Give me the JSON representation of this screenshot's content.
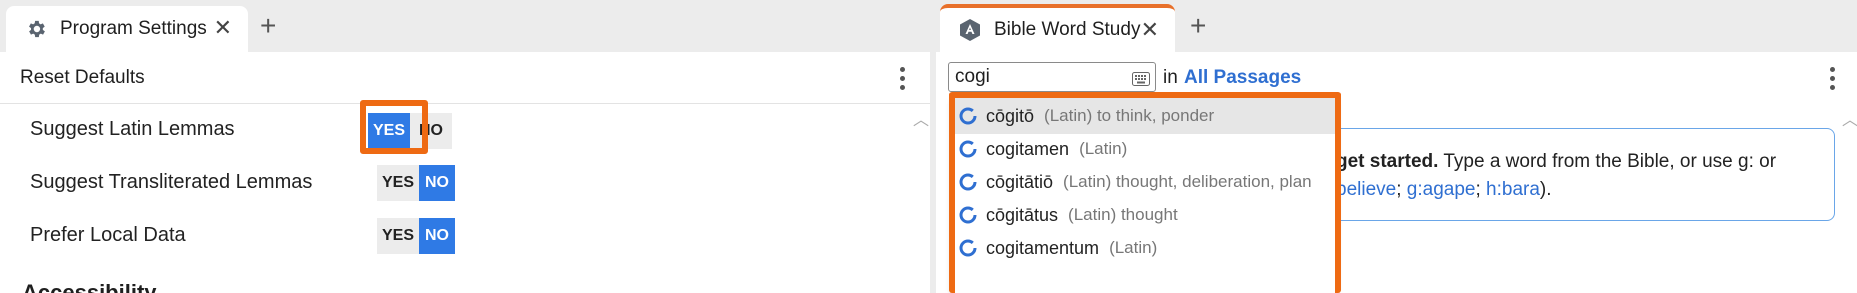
{
  "tabs": {
    "left": {
      "title": "Program Settings",
      "icon": "gear-icon",
      "close": "✕",
      "new_tab": "+"
    },
    "right": {
      "title": "Bible Word Study",
      "icon": "word-study-icon",
      "close": "✕",
      "new_tab": "+",
      "accent_color": "#e8702a"
    }
  },
  "settings": {
    "reset_label": "Reset Defaults",
    "rows": [
      {
        "label": "Suggest Latin Lemmas",
        "yes": "YES",
        "no": "NO",
        "value": "YES"
      },
      {
        "label": "Suggest Transliterated Lemmas",
        "yes": "YES",
        "no": "NO",
        "value": "NO"
      },
      {
        "label": "Prefer Local Data",
        "yes": "YES",
        "no": "NO",
        "value": "NO"
      }
    ],
    "next_section": "Accessibility"
  },
  "word_study": {
    "search_value": "cogi",
    "in_label": "in",
    "range_link": "All Passages",
    "info": {
      "line1_bold": "get started.",
      "line1_rest": " Type a word from the Bible, or use g: or",
      "line2_link1": "believe",
      "line2_sep1": "; ",
      "line2_link2": "g:agape",
      "line2_sep2": "; ",
      "line2_link3": "h:bara",
      "line2_end": ")."
    },
    "suggestions": [
      {
        "lemma": "cōgitō",
        "gloss": "(Latin) to think, ponder"
      },
      {
        "lemma": "cogitamen",
        "gloss": "(Latin)"
      },
      {
        "lemma": "cōgitātiō",
        "gloss": "(Latin) thought, deliberation, plan"
      },
      {
        "lemma": "cōgitātus",
        "gloss": "(Latin) thought"
      },
      {
        "lemma": "cogitamentum",
        "gloss": "(Latin)"
      }
    ]
  },
  "colors": {
    "accent_blue": "#2f7ae5",
    "highlight_orange": "#ee6a13",
    "link_blue": "#2f6fd1"
  }
}
